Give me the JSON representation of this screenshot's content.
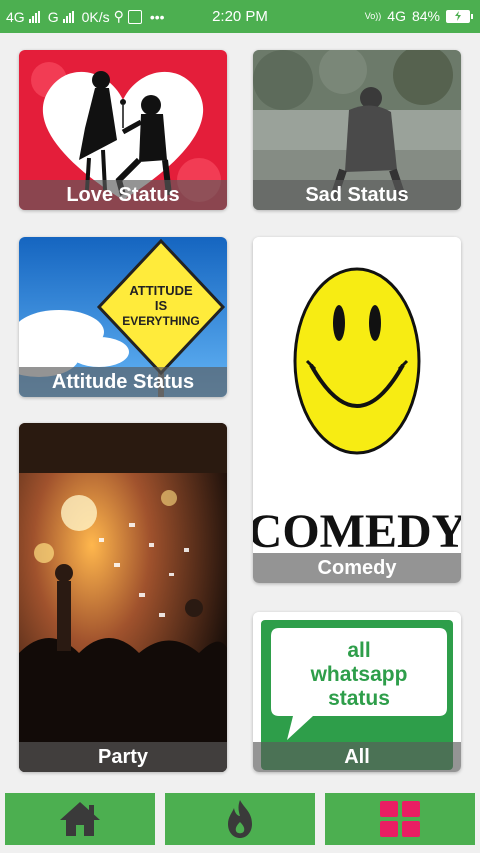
{
  "status_bar": {
    "net1": "4G",
    "net2": "G",
    "speed": "0K/s",
    "dots": "•••",
    "time": "2:20 PM",
    "volte": "Vo))",
    "net3": "4G",
    "battery": "84%"
  },
  "cards": {
    "love": "Love Status",
    "sad": "Sad Status",
    "attitude": "Attitude Status",
    "comedy": "Comedy",
    "party": "Party",
    "all": "All"
  },
  "sign_text": {
    "line1": "ATTITUDE",
    "line2": "IS",
    "line3": "EVERYTHING"
  },
  "comedy_text": "COMEDY",
  "whatsapp_text": {
    "line1": "all",
    "line2": "whatsapp",
    "line3": "status"
  },
  "nav": {
    "home": "home-icon",
    "fire": "fire-icon",
    "grid": "grid-icon"
  },
  "colors": {
    "accent": "#4caf50",
    "grid_icon": "#e91e63"
  }
}
